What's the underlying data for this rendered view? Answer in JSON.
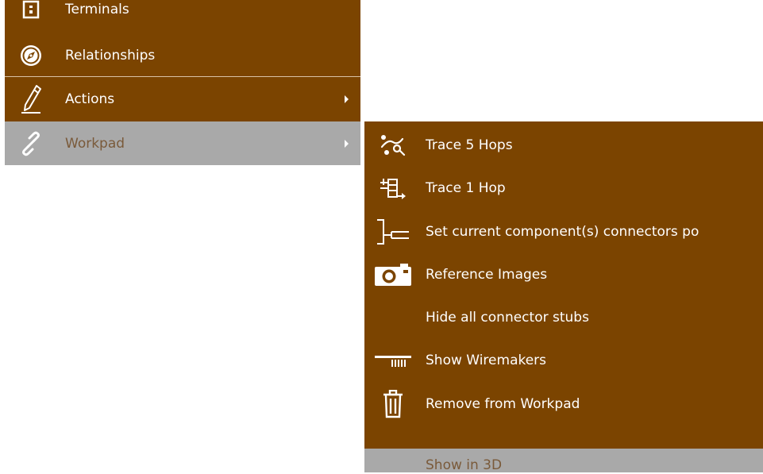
{
  "main_menu": {
    "items": [
      {
        "label": "Terminals",
        "icon": "terminal-icon"
      },
      {
        "label": "Relationships",
        "icon": "compass-icon"
      },
      {
        "label": "Actions",
        "icon": "pencil-icon",
        "has_submenu": true
      },
      {
        "label": "Workpad",
        "icon": "link-icon",
        "has_submenu": true,
        "highlighted": true
      }
    ]
  },
  "sub_menu": {
    "items": [
      {
        "label": "Trace 5 Hops",
        "icon": "trace-hops-icon"
      },
      {
        "label": "Trace 1 Hop",
        "icon": "trace-hop-icon"
      },
      {
        "label": "Set current component(s) connectors po",
        "icon": "connector-position-icon"
      },
      {
        "label": "Reference Images",
        "icon": "camera-icon"
      },
      {
        "label": "Hide all connector stubs",
        "icon": ""
      },
      {
        "label": "Show Wiremakers",
        "icon": "wiremaker-icon"
      },
      {
        "label": "Remove from Workpad",
        "icon": "trash-icon"
      },
      {
        "label": "Show in 3D",
        "icon": "",
        "highlighted": true
      }
    ]
  },
  "colors": {
    "menu_background": "#7b4400",
    "highlight_background": "#a9a9a9",
    "highlight_text": "#7a5a3a",
    "text": "#ffffff"
  }
}
